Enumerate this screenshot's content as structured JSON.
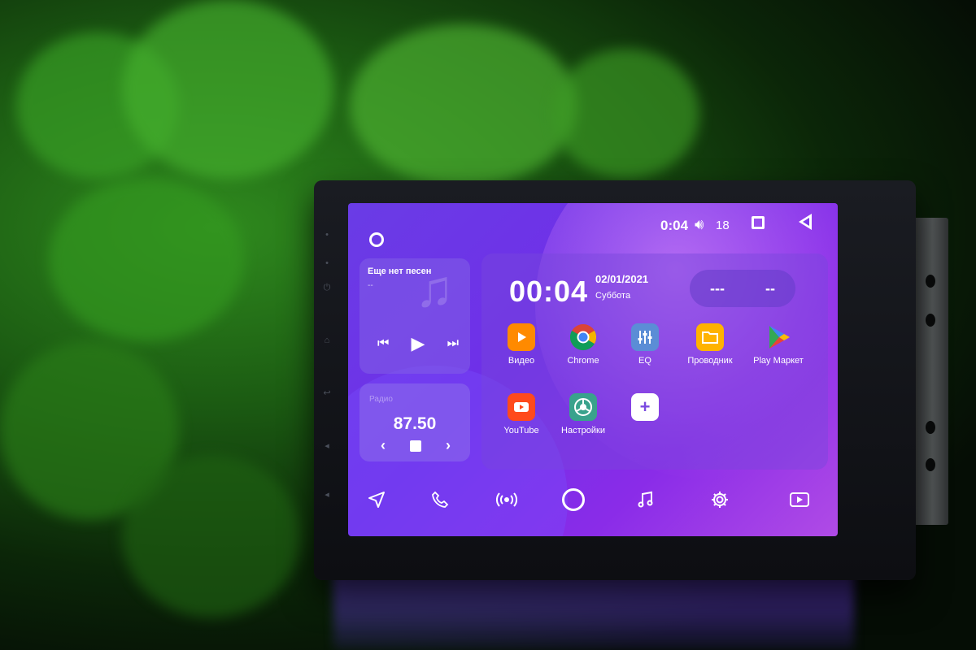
{
  "status_bar": {
    "time": "0:04",
    "volume_icon": "speaker-icon",
    "volume_level": "18",
    "recents_icon": "square-icon",
    "back_icon": "back-triangle-icon"
  },
  "music": {
    "title": "Еще нет песен",
    "artist": "--",
    "icons": [
      "prev-icon",
      "play-icon",
      "next-icon"
    ]
  },
  "radio": {
    "label": "Радио",
    "frequency": "87.50"
  },
  "clock": {
    "time": "00:04",
    "date": "02/01/2021",
    "weekday": "Суббота"
  },
  "weather": {
    "left": "---",
    "right": "--"
  },
  "apps": [
    {
      "label": "Видео",
      "icon": "video-icon",
      "color": "#ff8a00"
    },
    {
      "label": "Chrome",
      "icon": "chrome-icon",
      "color": "#ffffff"
    },
    {
      "label": "EQ",
      "icon": "equalizer-icon",
      "color": "#5b8dd6"
    },
    {
      "label": "Проводник",
      "icon": "folder-icon",
      "color": "#ffb300"
    },
    {
      "label": "Play Маркет",
      "icon": "play-store-icon",
      "color": "#ffffff"
    },
    {
      "label": "YouTube",
      "icon": "youtube-icon",
      "color": "#ff4a1c"
    },
    {
      "label": "Настройки",
      "icon": "settings-app-icon",
      "color": "#39a28c"
    },
    {
      "label": "",
      "icon": "add-icon",
      "color": "#ffffff"
    }
  ],
  "dock": [
    "navigation-icon",
    "phone-icon",
    "radio-wave-icon",
    "home-circle-icon",
    "music-note-icon",
    "gear-icon",
    "video-player-icon"
  ]
}
